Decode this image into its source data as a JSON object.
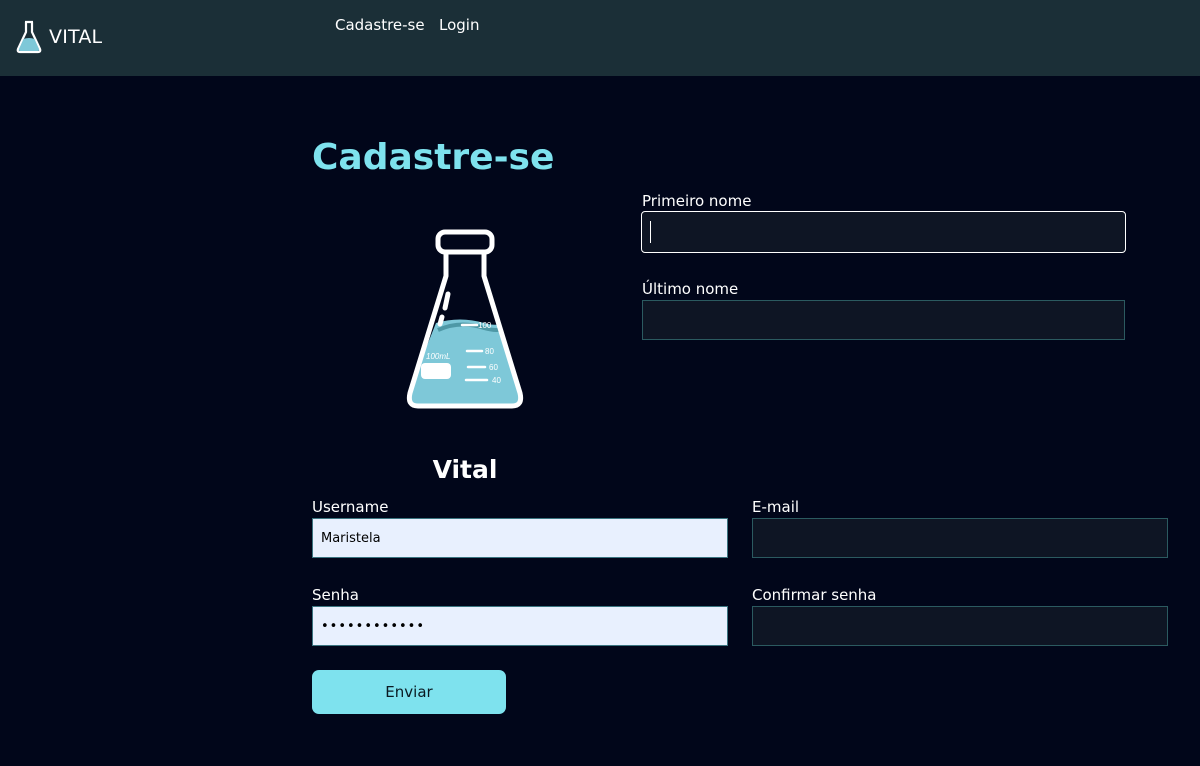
{
  "nav": {
    "brand": "VITAL",
    "brand_icon": "flask-icon",
    "links": [
      "Cadastre-se",
      "Login"
    ]
  },
  "form": {
    "title": "Cadastre-se",
    "hero_icon": "flask-icon",
    "hero_flask_marks": [
      "100mL",
      "100",
      "80",
      "60",
      "40"
    ],
    "hero_label": "Vital",
    "fields": {
      "first_name": {
        "label": "Primeiro nome",
        "value": ""
      },
      "last_name": {
        "label": "Último nome",
        "value": ""
      },
      "username": {
        "label": "Username",
        "value": "Maristela"
      },
      "email": {
        "label": "E-mail",
        "value": ""
      },
      "password": {
        "label": "Senha",
        "value": "••••••••••••"
      },
      "confirm_password": {
        "label": "Confirmar senha",
        "value": ""
      }
    },
    "submit_label": "Enviar"
  },
  "colors": {
    "navbar_bg": "#1b2f37",
    "page_bg": "#01061a",
    "accent": "#7ee2ee",
    "input_dark": "#0e1524",
    "input_filled": "#e8f0fe"
  }
}
